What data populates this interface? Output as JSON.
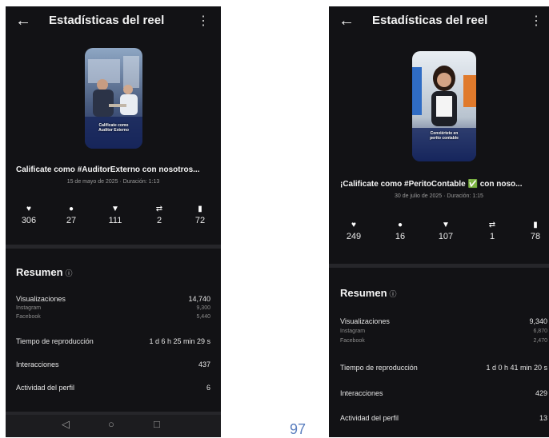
{
  "screen1": {
    "header": {
      "back_icon": "←",
      "title": "Estadísticas del reel",
      "menu_icon": "⋮"
    },
    "thumbnail": {
      "caption_line1": "Calificate como",
      "caption_line2": "Auditor Externo"
    },
    "reel_title": "Calificate como #AuditorExterno con nosotros...",
    "meta": "15 de mayo de 2025 · Duración: 1:13",
    "stats": {
      "likes": "306",
      "comments": "27",
      "shares": "111",
      "reposts": "2",
      "saves": "72"
    },
    "summary": {
      "title": "Resumen",
      "info_icon": "ⓘ",
      "views_label": "Visualizaciones",
      "views_value": "14,740",
      "instagram_label": "Instagram",
      "instagram_value": "9,300",
      "facebook_label": "Facebook",
      "facebook_value": "5,440",
      "watch_time_label": "Tiempo de reproducción",
      "watch_time_value": "1 d 6 h 25 min 29 s",
      "interactions_label": "Interacciones",
      "interactions_value": "437",
      "profile_activity_label": "Actividad del perfil",
      "profile_activity_value": "6"
    },
    "navbar": {
      "back": "◁",
      "home": "○",
      "recents": "□"
    }
  },
  "screen2": {
    "header": {
      "back_icon": "←",
      "title": "Estadísticas del reel",
      "menu_icon": "⋮"
    },
    "thumbnail": {
      "caption_line1": "Conviértete en",
      "caption_line2": "perito contable"
    },
    "reel_title": "¡Calificate como #PeritoContable ✅ con noso...",
    "meta": "30 de julio de 2025 · Duración: 1:15",
    "stats": {
      "likes": "249",
      "comments": "16",
      "shares": "107",
      "reposts": "1",
      "saves": "78"
    },
    "summary": {
      "title": "Resumen",
      "info_icon": "ⓘ",
      "views_label": "Visualizaciones",
      "views_value": "9,340",
      "instagram_label": "Instagram",
      "instagram_value": "6,870",
      "facebook_label": "Facebook",
      "facebook_value": "2,470",
      "watch_time_label": "Tiempo de reproducción",
      "watch_time_value": "1 d 0 h 41 min 20 s",
      "interactions_label": "Interacciones",
      "interactions_value": "429",
      "profile_activity_label": "Actividad del perfil",
      "profile_activity_value": "13"
    }
  },
  "page_number": "97"
}
